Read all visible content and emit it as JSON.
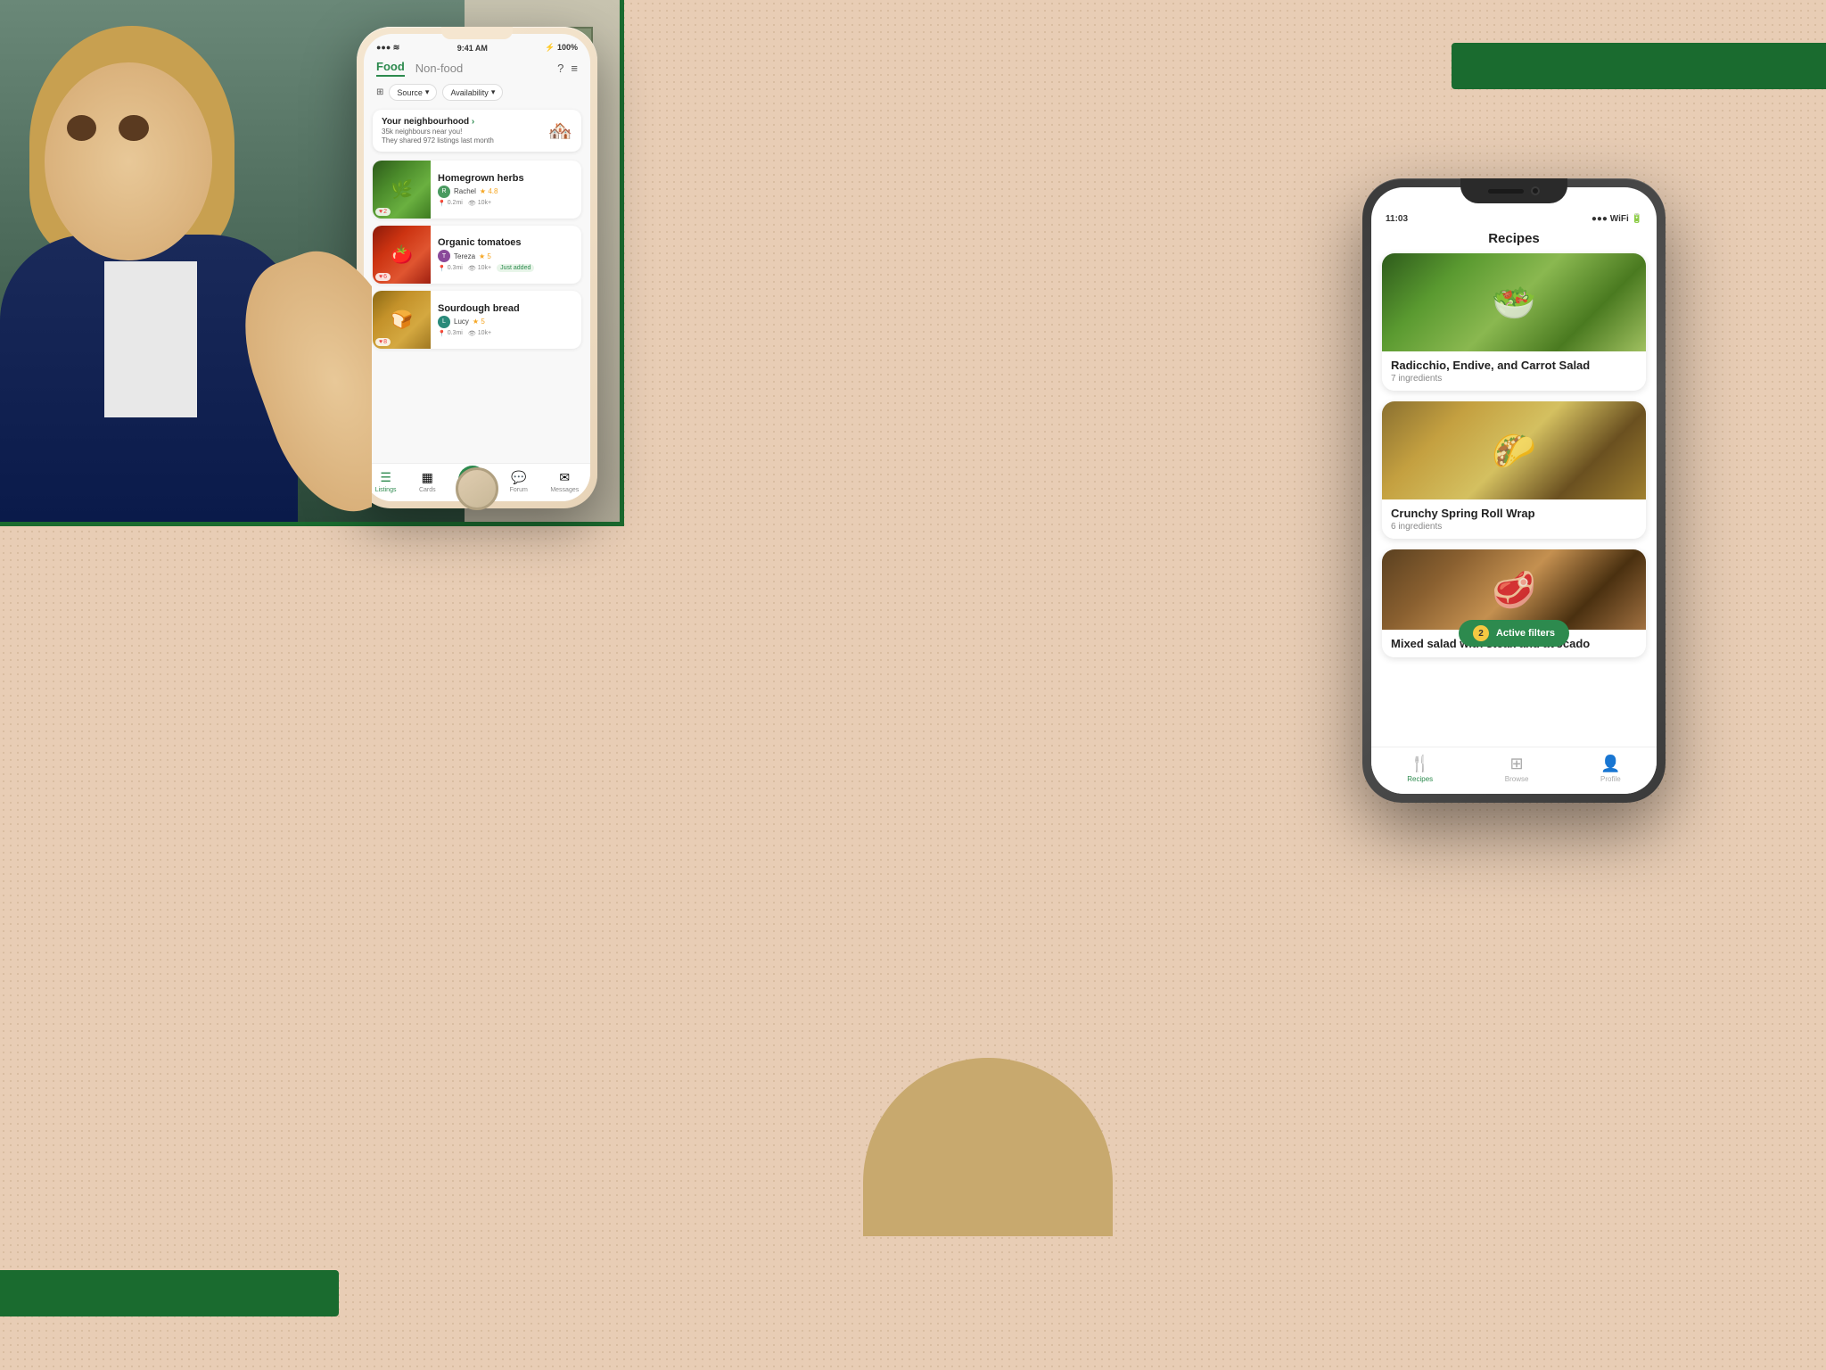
{
  "background": {
    "color": "#e8cdb5"
  },
  "decorative": {
    "green_bar_top": "green accent bar top right",
    "green_bar_bottom": "green accent bar bottom left",
    "gold_circle": "gold decorative circle"
  },
  "photo": {
    "alt": "Person handing over vegetables"
  },
  "phone1": {
    "status_bar": {
      "time": "9:41 AM",
      "signal": "●●●●",
      "wifi": "WiFi",
      "battery": "100%"
    },
    "tabs": {
      "food": "Food",
      "non_food": "Non-food"
    },
    "filters": {
      "source": "Source",
      "availability": "Availability"
    },
    "neighbourhood": {
      "title": "Your neighbourhood",
      "subtitle": "35k neighbours near you!",
      "detail": "They shared 972 listings last month"
    },
    "listings": [
      {
        "title": "Homegrown herbs",
        "user": "Rachel",
        "rating": "4.8",
        "distance": "0.2mi",
        "count": "10k+",
        "badge": "",
        "hearts": "2",
        "img_type": "herbs"
      },
      {
        "title": "Organic tomatoes",
        "user": "Tereza",
        "rating": "5",
        "distance": "0.3mi",
        "count": "10k+",
        "badge": "Just added",
        "hearts": "6",
        "img_type": "tomatoes"
      },
      {
        "title": "Sourdough bread",
        "user": "Lucy",
        "rating": "5",
        "distance": "0.3mi",
        "count": "10k+",
        "badge": "",
        "hearts": "8",
        "img_type": "bread"
      }
    ],
    "bottom_nav": [
      {
        "label": "Listings",
        "icon": "☰",
        "active": true
      },
      {
        "label": "Cards",
        "icon": "▦",
        "active": false
      },
      {
        "label": "+",
        "icon": "+",
        "active": false,
        "is_add": true
      },
      {
        "label": "Forum",
        "icon": "💬",
        "active": false
      },
      {
        "label": "Messages",
        "icon": "✉",
        "active": false
      }
    ]
  },
  "phone2": {
    "status_bar": {
      "time": "11:03",
      "battery": "●●●",
      "wifi": "WiFi"
    },
    "title": "Recipes",
    "recipes": [
      {
        "title": "Radicchio, Endive, and Carrot Salad",
        "ingredients": "7 ingredients",
        "img_type": "salad"
      },
      {
        "title": "Crunchy Spring Roll Wrap",
        "ingredients": "6 ingredients",
        "img_type": "wrap"
      },
      {
        "title": "Mixed salad with steak and avocado",
        "ingredients": "",
        "img_type": "steak"
      }
    ],
    "active_filters": {
      "count": "2",
      "label": "Active filters"
    },
    "bottom_nav": [
      {
        "label": "Recipes",
        "icon": "🍴",
        "active": true
      },
      {
        "label": "Browse",
        "icon": "⊞",
        "active": false
      },
      {
        "label": "Profile",
        "icon": "👤",
        "active": false
      }
    ]
  }
}
